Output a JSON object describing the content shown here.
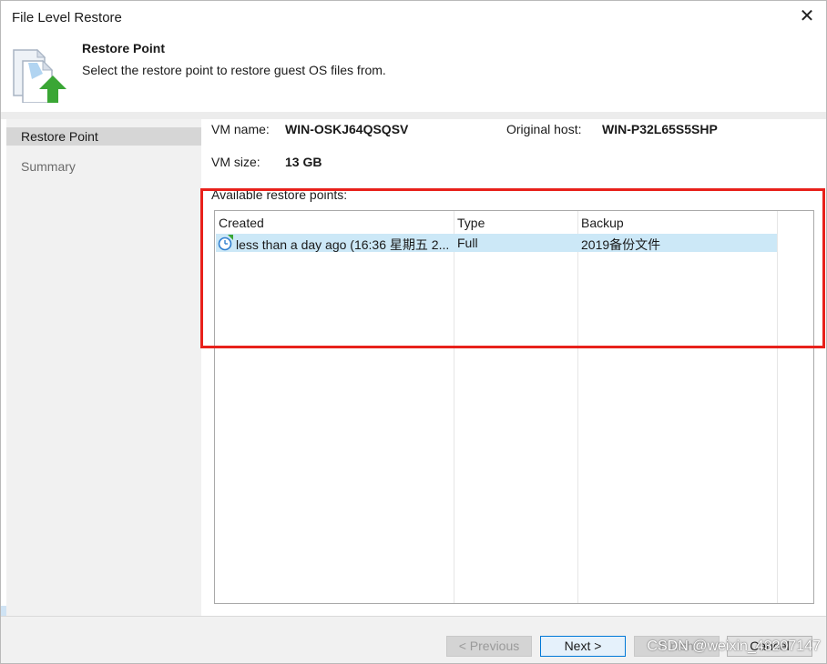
{
  "window": {
    "title": "File Level Restore",
    "close_glyph": "✕"
  },
  "header": {
    "title": "Restore Point",
    "subtitle": "Select the restore point to restore guest OS files from.",
    "icon": "restore-document-icon"
  },
  "sidebar": {
    "items": [
      {
        "label": "Restore Point",
        "active": true
      },
      {
        "label": "Summary",
        "active": false
      }
    ]
  },
  "vm_info": {
    "name_label": "VM name:",
    "name_value": "WIN-OSKJ64QSQSV",
    "host_label": "Original host:",
    "host_value": "WIN-P32L65S5SHP",
    "size_label": "VM size:",
    "size_value": "13 GB"
  },
  "restore_points": {
    "label": "Available restore points:",
    "columns": [
      "Created",
      "Type",
      "Backup"
    ],
    "rows": [
      {
        "created": "less than a day ago (16:36 星期五 2...",
        "type": "Full",
        "backup": "2019备份文件",
        "selected": true
      }
    ]
  },
  "footer": {
    "previous_label": "< Previous",
    "next_label": "Next >",
    "finish_label": "Finish",
    "cancel_label": "Cancel"
  },
  "watermark": "CSDN @weixin_43207147",
  "colors": {
    "highlight_border": "#e8211b",
    "selected_row": "#cce8f7",
    "sidebar_bg": "#f1f1f1",
    "arrow_green": "#3aa635"
  }
}
